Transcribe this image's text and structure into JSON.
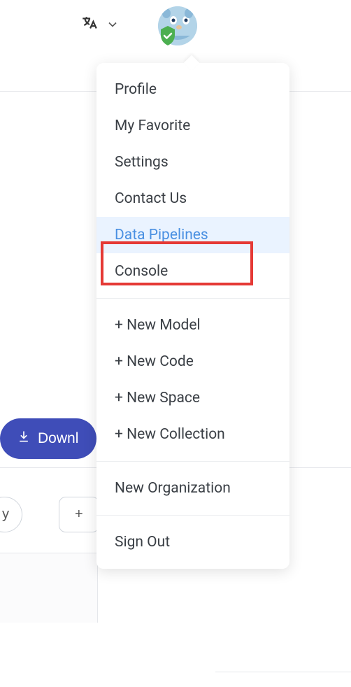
{
  "header": {
    "lang_icon": "translate-icon",
    "chevron_icon": "chevron-down-icon",
    "avatar_alt": "user-avatar",
    "avatar_colors": {
      "bg": "#b3d4e8",
      "accent": "#6aa8d8",
      "badge": "#4caf50"
    }
  },
  "menu": {
    "section1": [
      "Profile",
      "My Favorite",
      "Settings",
      "Contact Us",
      "Data Pipelines",
      "Console"
    ],
    "section2": [
      "+ New Model",
      "+ New Code",
      "+ New Space",
      "+ New Collection"
    ],
    "section3": [
      "New Organization"
    ],
    "section4": [
      "Sign Out"
    ],
    "highlighted_index": 4
  },
  "background": {
    "download_label": "Downl",
    "pill_left_label": "y",
    "pill_plus_label": "+"
  },
  "highlight": {
    "target": "Data Pipelines",
    "color": "#e53935"
  }
}
